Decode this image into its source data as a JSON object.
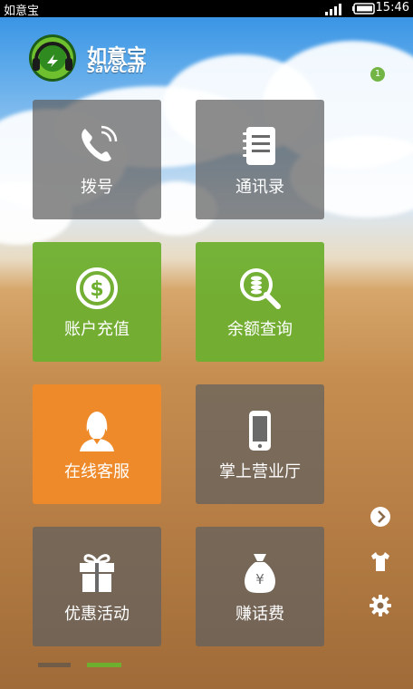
{
  "status_bar": {
    "app_name": "如意宝",
    "time": "15:46"
  },
  "brand": {
    "name_cn": "如意宝",
    "name_en": "SaveCall"
  },
  "notification": {
    "count": "1"
  },
  "tiles": [
    {
      "label": "拨号",
      "icon": "phone-icon",
      "style": "gray"
    },
    {
      "label": "通讯录",
      "icon": "address-book-icon",
      "style": "gray"
    },
    {
      "label": "账户充值",
      "icon": "dollar-coin-icon",
      "style": "green"
    },
    {
      "label": "余额查询",
      "icon": "magnifier-coins-icon",
      "style": "green"
    },
    {
      "label": "在线客服",
      "icon": "customer-service-icon",
      "style": "orange"
    },
    {
      "label": "掌上营业厅",
      "icon": "mobile-phone-icon",
      "style": "gray"
    },
    {
      "label": "优惠活动",
      "icon": "gift-icon",
      "style": "gray"
    },
    {
      "label": "赚话费",
      "icon": "money-bag-icon",
      "style": "gray"
    }
  ],
  "side_icons": [
    "arrow-right-circle-icon",
    "tshirt-icon",
    "gear-icon"
  ],
  "pager": {
    "pages": 2,
    "active": 2
  },
  "colors": {
    "green": "#6eaf30",
    "orange": "#f08a28",
    "tile_gray": "#5f5f5f",
    "badge": "#72b545"
  }
}
